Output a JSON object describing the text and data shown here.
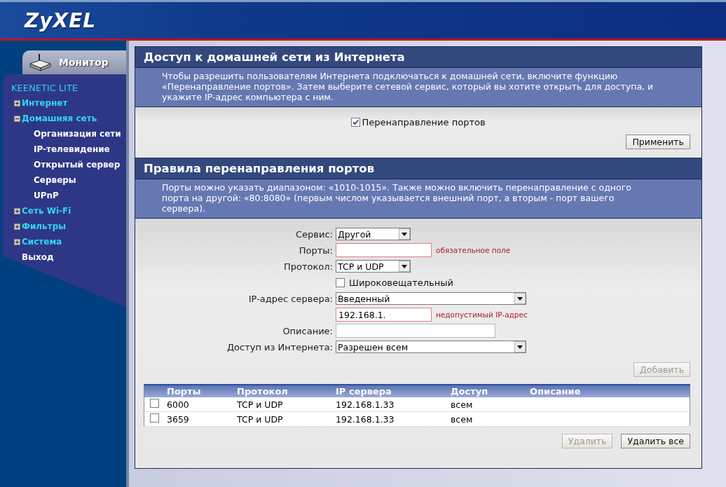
{
  "header": {
    "logo": "ZyXEL"
  },
  "sidebar": {
    "tab": "Монитор",
    "model": "KEENETIC LITE",
    "items": [
      {
        "label": "Интернет",
        "expanded": false
      },
      {
        "label": "Домашняя сеть",
        "expanded": true,
        "children": [
          {
            "label": "Организация сети"
          },
          {
            "label": "IP-телевидение"
          },
          {
            "label": "Открытый сервер"
          },
          {
            "label": "Серверы"
          },
          {
            "label": "UPnP"
          }
        ]
      },
      {
        "label": "Сеть Wi-Fi",
        "expanded": false
      },
      {
        "label": "Фильтры",
        "expanded": false
      },
      {
        "label": "Система",
        "expanded": false
      },
      {
        "label": "Выход"
      }
    ]
  },
  "access_section": {
    "title": "Доступ к домашней сети из Интернета",
    "description": "Чтобы разрешить пользователям Интернета подключаться к домашней сети, включите функцию «Перенаправление портов». Затем выберите сетевой сервис, который вы хотите открыть для доступа, и укажите IP-адрес компьютера с ним.",
    "checkbox": {
      "label": "Перенаправление портов",
      "checked": true
    },
    "apply_button": {
      "label": "Применить",
      "disabled": false
    }
  },
  "rules_section": {
    "title": "Правила перенаправления портов",
    "description": "Порты можно указать диапазоном: «1010-1015». Также можно включить перенаправление с одного порта на другой: «80:8080» (первым числом указывается внешний порт, а вторым - порт вашего сервера).",
    "form": [
      {
        "kind": "select",
        "label": "Сервис:",
        "value": "Другой"
      },
      {
        "kind": "input",
        "label": "Порты:",
        "error": "обязательное поле"
      },
      {
        "kind": "select",
        "label": "Протокол:",
        "value": "TCP и UDP"
      },
      {
        "kind": "checkbox",
        "label": "Широковещательный",
        "checked": false
      },
      {
        "kind": "wideselect",
        "label": "IP-адрес сервера:",
        "value": "Введенный"
      },
      {
        "kind": "input",
        "value": "192.168.1.",
        "error": "недопустимый IP-адрес"
      },
      {
        "kind": "wideinput",
        "label": "Описание:"
      },
      {
        "kind": "wideselect",
        "label": "Доступ из Интернета:",
        "value": "Разрешен всем"
      }
    ],
    "add_button": {
      "label": "Добавить",
      "disabled": true
    },
    "table": {
      "columns": [
        "Порты",
        "Протокол",
        "IP сервера",
        "Доступ",
        "Описание"
      ],
      "rows": [
        {
          "checked": false,
          "cells": [
            "6000",
            "TCP и UDP",
            "192.168.1.33",
            "всем"
          ]
        },
        {
          "checked": false,
          "cells": [
            "3659",
            "TCP и UDP",
            "192.168.1.33",
            "всем"
          ]
        }
      ]
    },
    "buttons": [
      {
        "label": "Удалить",
        "disabled": true
      },
      {
        "label": "Удалить все",
        "disabled": false
      }
    ]
  }
}
